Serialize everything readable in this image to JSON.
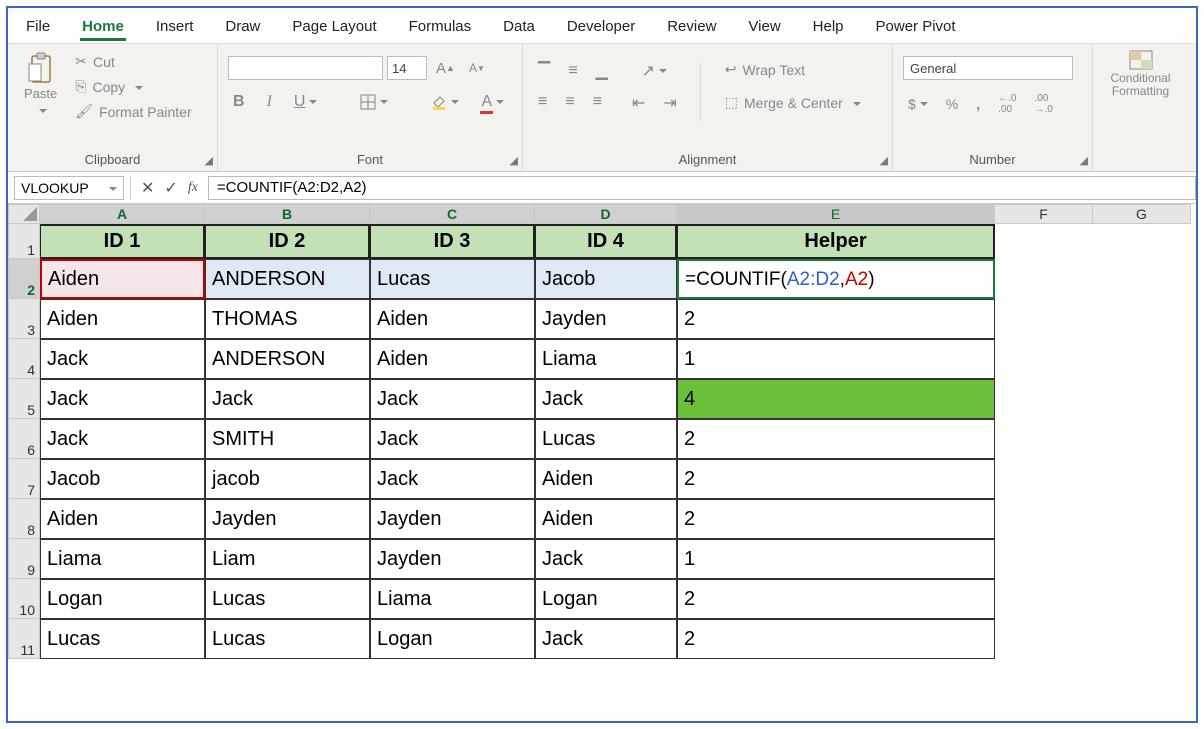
{
  "menubar": {
    "items": [
      "File",
      "Home",
      "Insert",
      "Draw",
      "Page Layout",
      "Formulas",
      "Data",
      "Developer",
      "Review",
      "View",
      "Help",
      "Power Pivot"
    ],
    "active_index": 1
  },
  "ribbon": {
    "clipboard": {
      "title": "Clipboard",
      "paste": "Paste",
      "cut": "Cut",
      "copy": "Copy",
      "format_painter": "Format Painter"
    },
    "font": {
      "title": "Font",
      "size": "14",
      "A_up": "A",
      "A_down": "A",
      "B": "B",
      "I": "I",
      "U": "U"
    },
    "alignment": {
      "title": "Alignment",
      "wrap": "Wrap Text",
      "merge": "Merge & Center"
    },
    "number": {
      "title": "Number",
      "format": "General",
      "currency": "$",
      "percent": "%",
      "comma": ",",
      "dec_inc_icon": "←.0 .00",
      "dec_dec_icon": ".00 →.0"
    },
    "cond": "Conditional Formatting"
  },
  "formula_bar": {
    "name_box": "VLOOKUP",
    "fx": "fx",
    "formula": "=COUNTIF(A2:D2,A2)"
  },
  "grid": {
    "col_widths": {
      "A": 165,
      "B": 165,
      "C": 165,
      "D": 142,
      "E": 318,
      "F": 98,
      "G": 98
    },
    "columns": [
      "A",
      "B",
      "C",
      "D",
      "E",
      "F",
      "G"
    ],
    "headers": [
      "ID 1",
      "ID 2",
      "ID 3",
      "ID 4",
      "Helper"
    ],
    "edit_cell_parts": {
      "p1": "=COUNTIF(",
      "p2": "A2:D2",
      "p3": ",",
      "p4": "A2",
      "p5": ")"
    },
    "rows": [
      {
        "n": "2",
        "cells": [
          "Aiden",
          "ANDERSON",
          "Lucas",
          "Jacob",
          ""
        ],
        "edit": true
      },
      {
        "n": "3",
        "cells": [
          "Aiden",
          "THOMAS",
          "Aiden",
          "Jayden",
          "2"
        ]
      },
      {
        "n": "4",
        "cells": [
          "Jack",
          "ANDERSON",
          "Aiden",
          "Liama",
          "1"
        ]
      },
      {
        "n": "5",
        "cells": [
          "Jack",
          "Jack",
          "Jack",
          "Jack",
          "4"
        ],
        "hiliteE": true
      },
      {
        "n": "6",
        "cells": [
          "Jack",
          "SMITH",
          "Jack",
          "Lucas",
          "2"
        ]
      },
      {
        "n": "7",
        "cells": [
          "Jacob",
          "jacob",
          "Jack",
          "Aiden",
          "2"
        ]
      },
      {
        "n": "8",
        "cells": [
          "Aiden",
          "Jayden",
          "Jayden",
          "Aiden",
          "2"
        ]
      },
      {
        "n": "9",
        "cells": [
          "Liama",
          "Liam",
          "Jayden",
          "Jack",
          "1"
        ]
      },
      {
        "n": "10",
        "cells": [
          "Logan",
          "Lucas",
          "Liama",
          "Logan",
          "2"
        ]
      },
      {
        "n": "11",
        "cells": [
          "Lucas",
          "Lucas",
          "Logan",
          "Jack",
          "2"
        ]
      }
    ]
  }
}
